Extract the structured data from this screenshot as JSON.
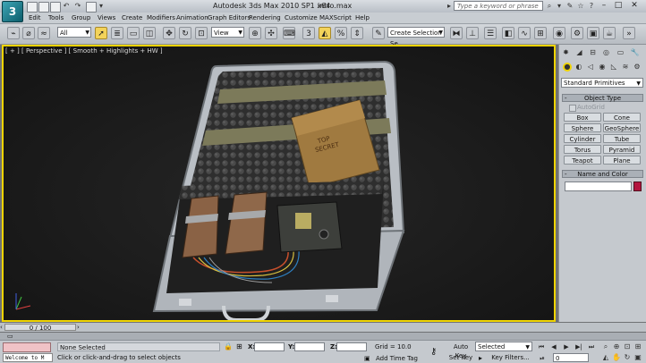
{
  "app": {
    "logo_text": "3",
    "title": "Autodesk 3ds Max 2010 SP1 x64",
    "file_name": "intro.max"
  },
  "search": {
    "placeholder": "Type a keyword or phrase"
  },
  "menu": [
    "Edit",
    "Tools",
    "Group",
    "Views",
    "Create",
    "Modifiers",
    "Animation",
    "Graph Editors",
    "Rendering",
    "Customize",
    "MAXScript",
    "Help"
  ],
  "toolbar": {
    "selection_filter": "All",
    "reference_coord": "View",
    "named_selection_placeholder": "Create Selection Se",
    "snap_label": "3",
    "angle_snap_label": "%"
  },
  "viewport": {
    "label": "[ + ] [ Perspective ] [ Smooth + Highlights + HW ]",
    "stamp_line1": "TOP",
    "stamp_line2": "SECRET",
    "accent_color": "#f0d400"
  },
  "command_panel": {
    "primitive_type": "Standard Primitives",
    "object_type_header": "Object Type",
    "autogrid_label": "AutoGrid",
    "buttons": [
      "Box",
      "Cone",
      "Sphere",
      "GeoSphere",
      "Cylinder",
      "Tube",
      "Torus",
      "Pyramid",
      "Teapot",
      "Plane"
    ],
    "name_color_header": "Name and Color",
    "object_color": "#b3153f"
  },
  "timeline": {
    "slider_text": "0 / 100"
  },
  "status": {
    "welcome_text": "Welcome to M",
    "selection": "None Selected",
    "prompt": "Click or click-and-drag to select objects",
    "x_label": "X:",
    "y_label": "Y:",
    "z_label": "Z:",
    "grid": "Grid = 10.0",
    "add_time_tag": "Add Time Tag",
    "auto_key": "Auto Key",
    "set_key": "Set Key",
    "key_filters": "Key Filters...",
    "key_mode": "Selected",
    "frame": "0"
  }
}
